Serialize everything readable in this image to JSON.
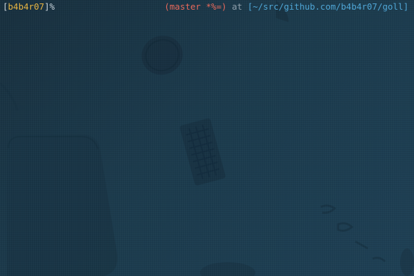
{
  "prompt": {
    "left_open": "[",
    "username": "b4b4r07",
    "left_close": "]",
    "prompt_char": "%",
    "git_info": "(master *%=)",
    "at_word": "at",
    "path_open": "[",
    "path": "~/src/github.com/b4b4r07/goll",
    "path_close": "]"
  },
  "colors": {
    "background": "#1c3b4d",
    "username": "#e8b542",
    "git_info": "#e8695b",
    "path": "#4fa6d6",
    "text": "#c9d4dc"
  },
  "wallpaper": {
    "description_icon": "spacecraft-wallpaper"
  }
}
